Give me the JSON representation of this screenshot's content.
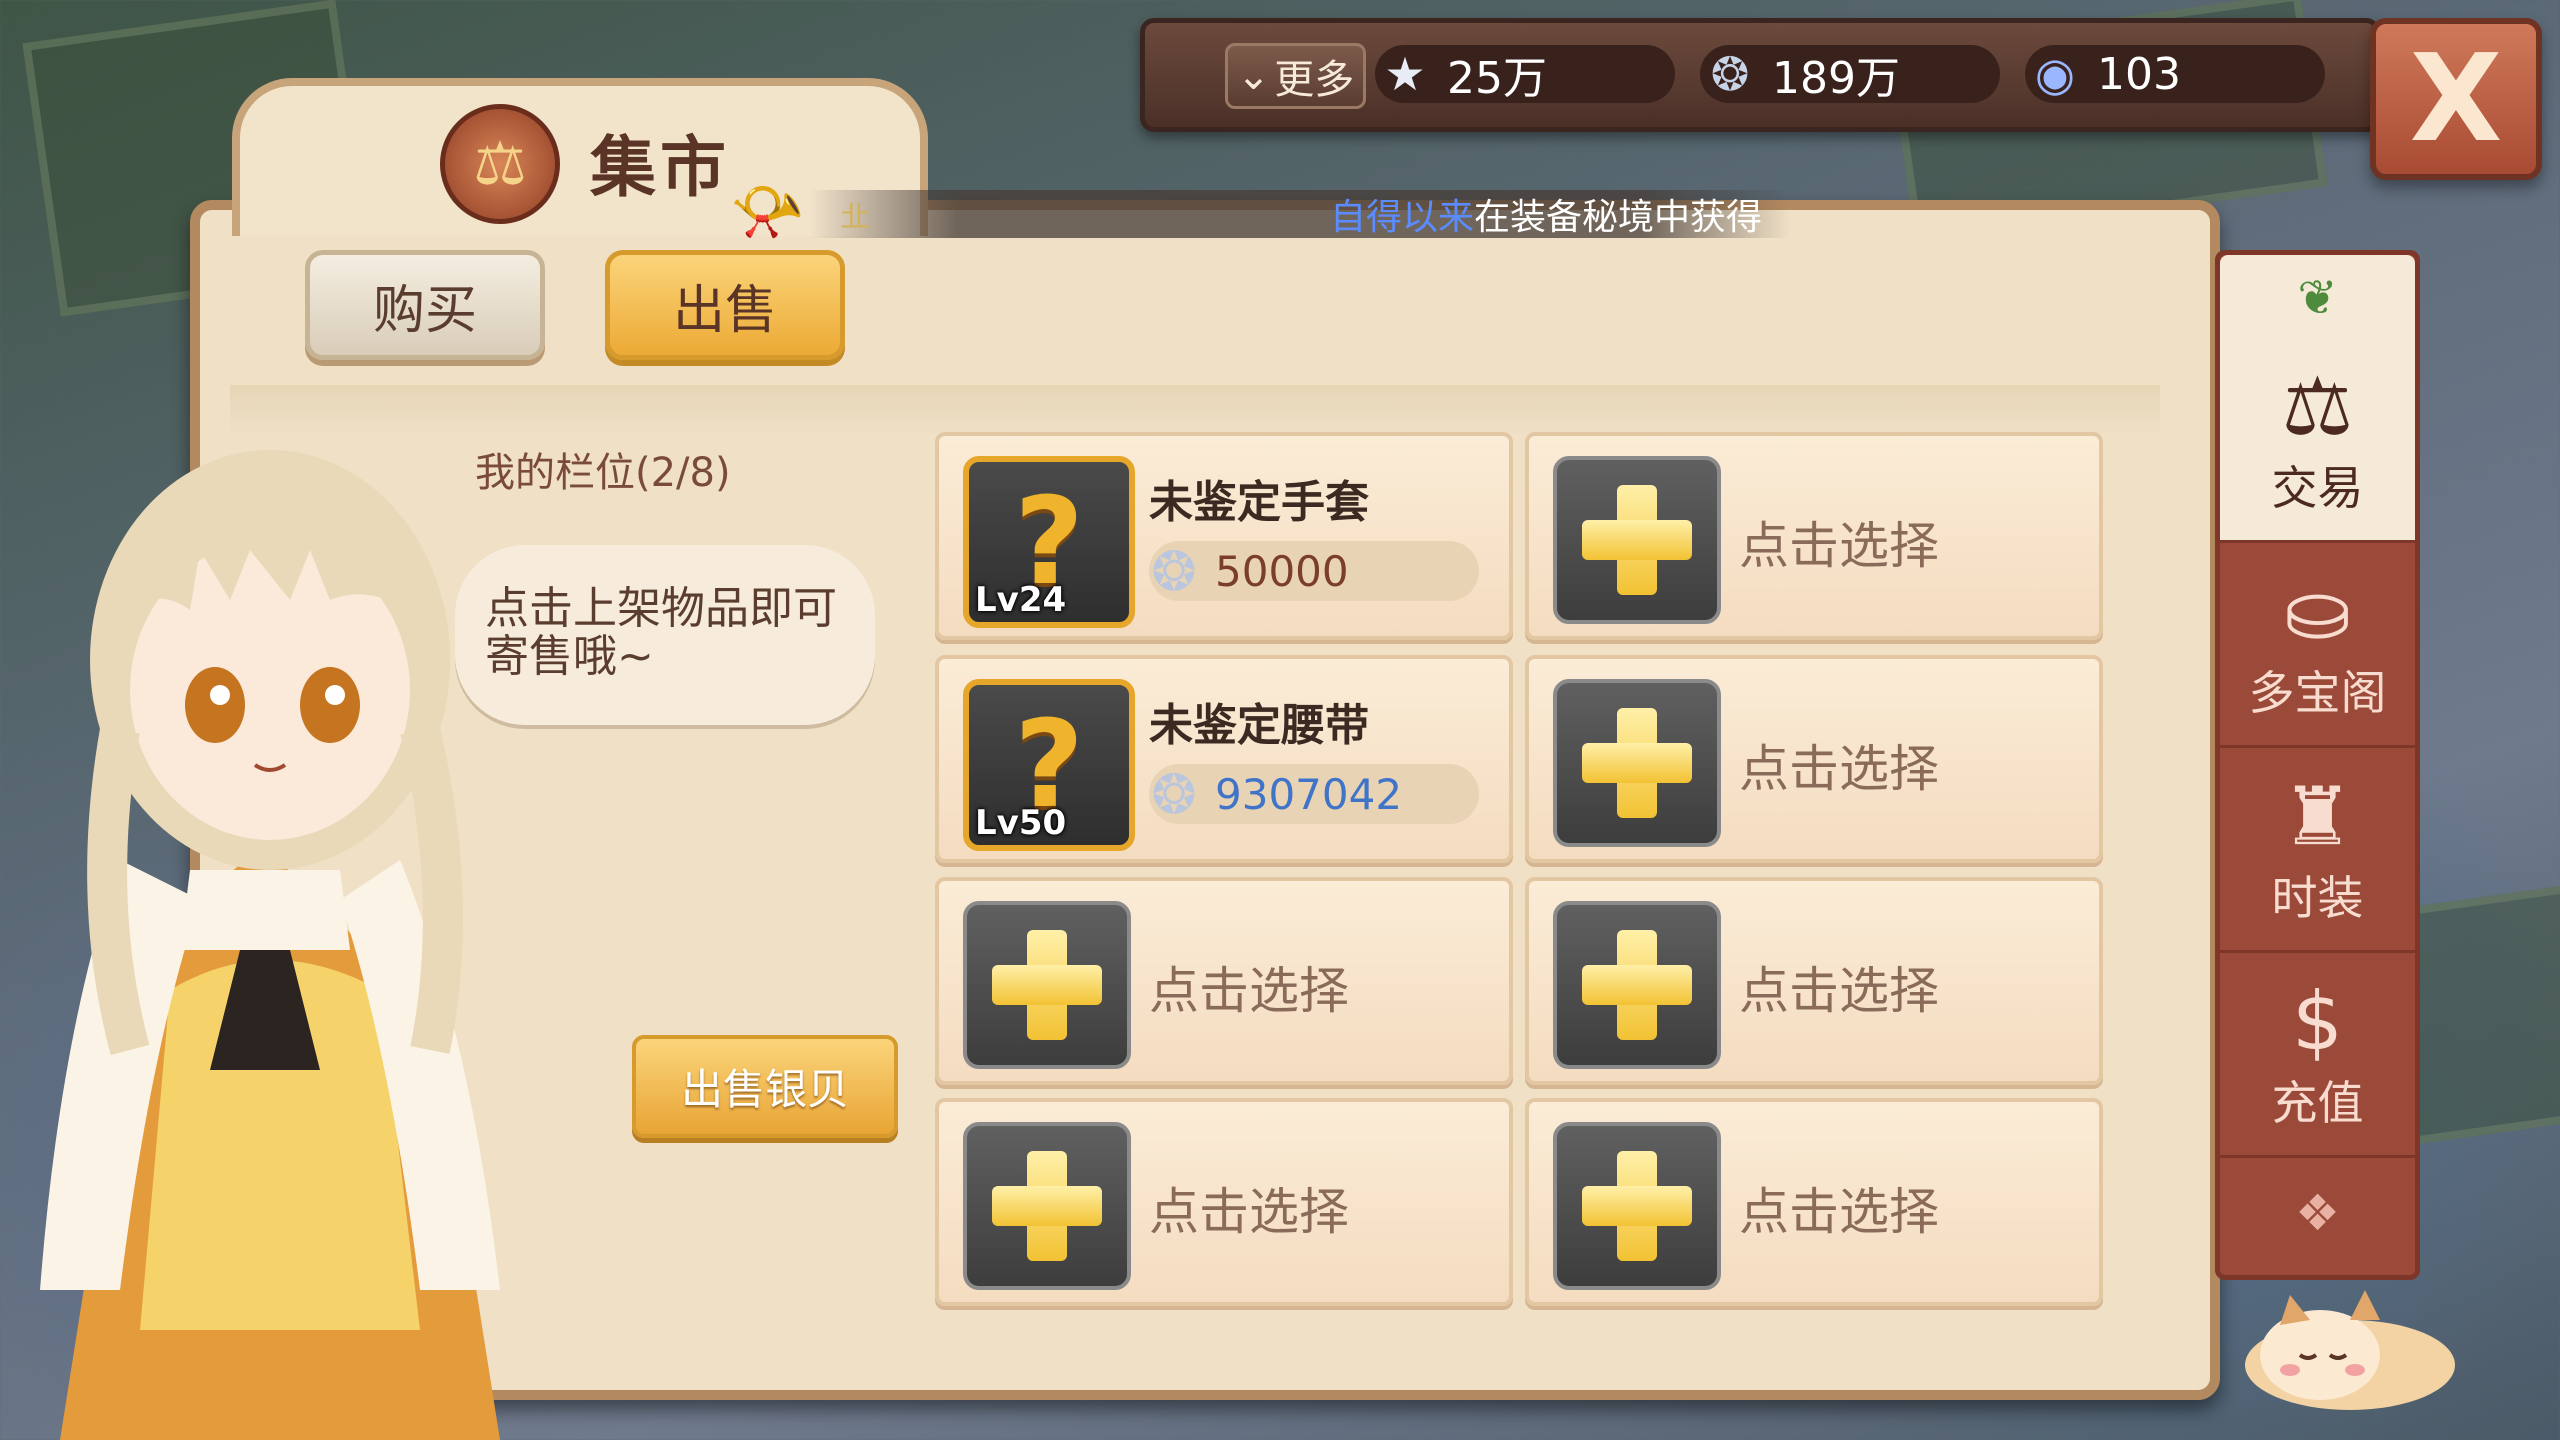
{
  "topbar": {
    "more_label": "更多",
    "currencies": [
      {
        "icon": "star-icon",
        "value": "25万"
      },
      {
        "icon": "shell-icon",
        "value": "189万"
      },
      {
        "icon": "crystal-icon",
        "value": "103"
      }
    ],
    "close_label": "X"
  },
  "panel": {
    "title": "集市",
    "ticker": {
      "highlight": "自得以来",
      "text": "在装备秘境中获得",
      "icon_text": "㐀"
    },
    "tabs": {
      "buy": "购买",
      "sell": "出售"
    },
    "slots_label": "我的栏位(2/8)",
    "speech": "点击上架物品即可寄售哦~",
    "sell_silver": "出售银贝"
  },
  "items": [
    {
      "name": "未鉴定手套",
      "level": "Lv24",
      "price": "50000",
      "price_color": "#7a3e2a"
    },
    {
      "name": "未鉴定腰带",
      "level": "Lv50",
      "price": "9307042",
      "price_color": "#3f74c9"
    }
  ],
  "empty_slot_label": "点击选择",
  "side_tabs": [
    {
      "label": "交易",
      "icon": "scales-icon",
      "active": true
    },
    {
      "label": "多宝阁",
      "icon": "treasure-chest-icon",
      "active": false
    },
    {
      "label": "时装",
      "icon": "coat-icon",
      "active": false
    },
    {
      "label": "充值",
      "icon": "dollar-icon",
      "active": false
    }
  ]
}
